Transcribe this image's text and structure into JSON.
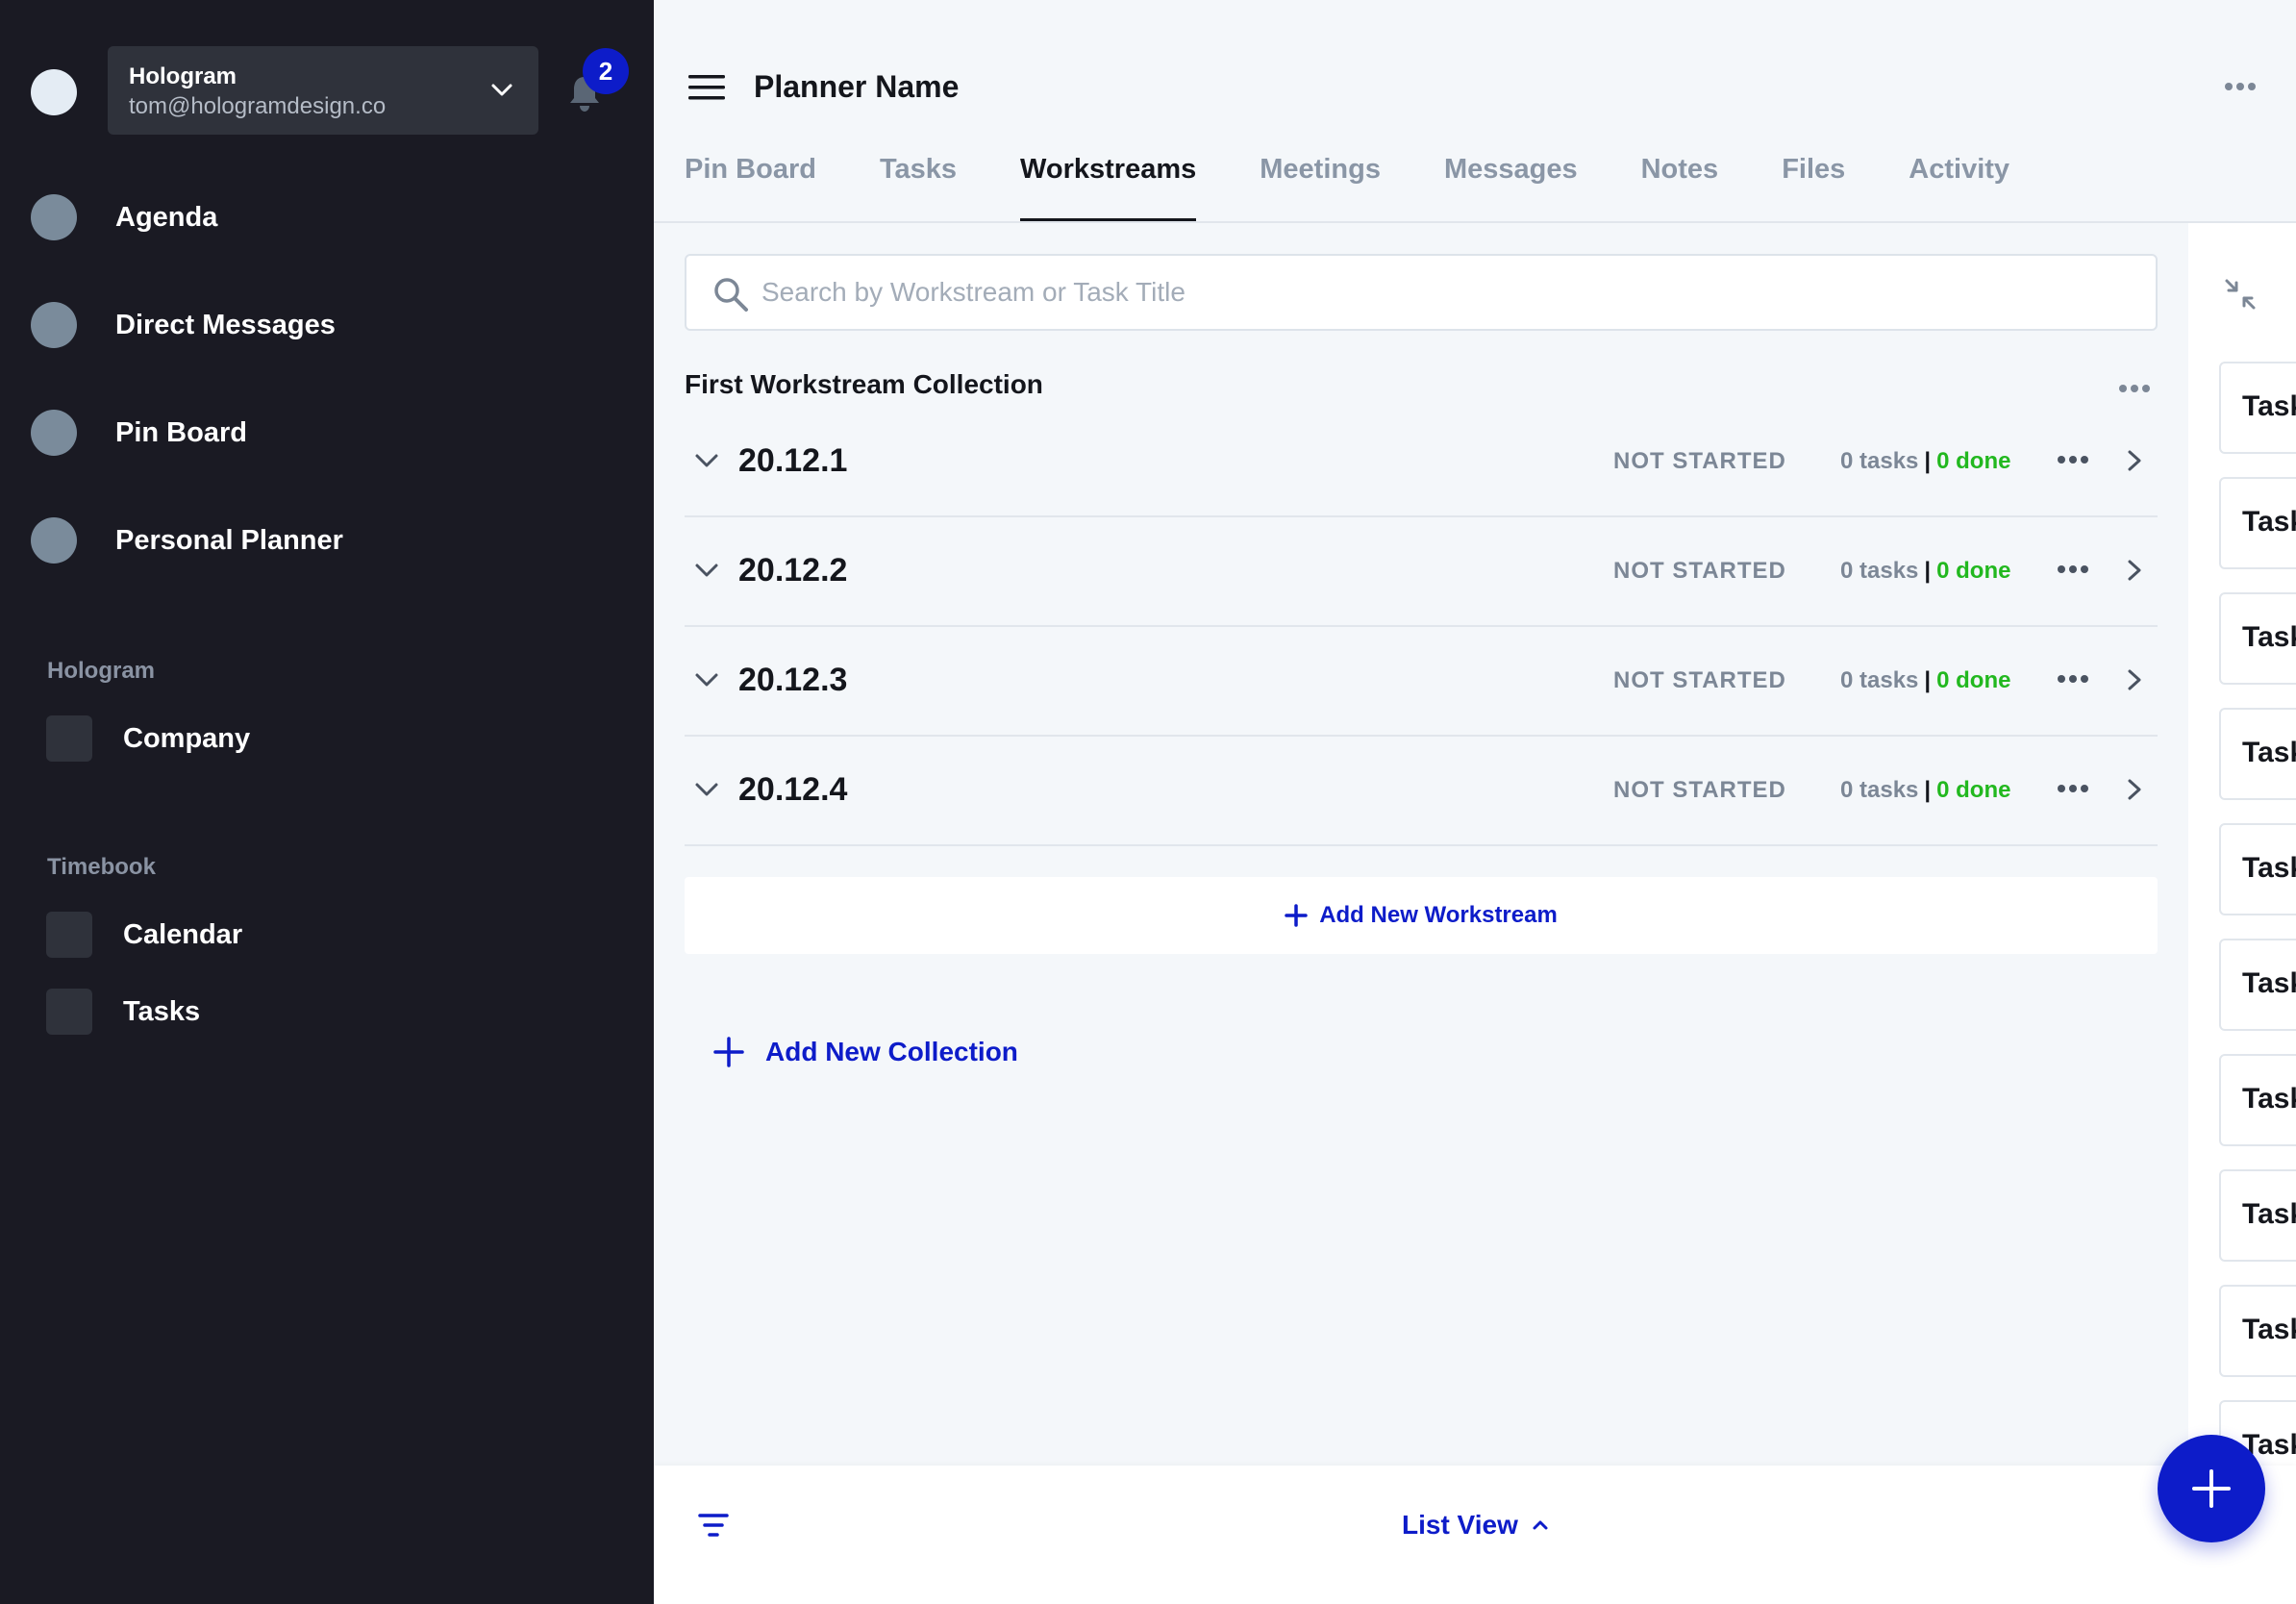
{
  "account": {
    "name": "Hologram",
    "email": "tom@hologramdesign.co",
    "notification_count": "2"
  },
  "sidebar": {
    "nav": [
      {
        "label": "Agenda"
      },
      {
        "label": "Direct Messages"
      },
      {
        "label": "Pin Board"
      },
      {
        "label": "Personal Planner"
      }
    ],
    "sections": [
      {
        "title": "Hologram",
        "items": [
          {
            "label": "Company"
          }
        ]
      },
      {
        "title": "Timebook",
        "items": [
          {
            "label": "Calendar"
          },
          {
            "label": "Tasks"
          }
        ]
      }
    ]
  },
  "header": {
    "title": "Planner Name",
    "tabs": [
      {
        "label": "Pin Board"
      },
      {
        "label": "Tasks"
      },
      {
        "label": "Workstreams",
        "active": true
      },
      {
        "label": "Meetings"
      },
      {
        "label": "Messages"
      },
      {
        "label": "Notes"
      },
      {
        "label": "Files"
      },
      {
        "label": "Activity"
      }
    ]
  },
  "search": {
    "placeholder": "Search by Workstream or Task Title",
    "value": ""
  },
  "collection": {
    "title": "First Workstream Collection",
    "workstreams": [
      {
        "name": "20.12.1",
        "status": "NOT STARTED",
        "tasks": "0 tasks",
        "sep": "|",
        "done": "0 done"
      },
      {
        "name": "20.12.2",
        "status": "NOT STARTED",
        "tasks": "0 tasks",
        "sep": "|",
        "done": "0 done"
      },
      {
        "name": "20.12.3",
        "status": "NOT STARTED",
        "tasks": "0 tasks",
        "sep": "|",
        "done": "0 done"
      },
      {
        "name": "20.12.4",
        "status": "NOT STARTED",
        "tasks": "0 tasks",
        "sep": "|",
        "done": "0 done"
      }
    ],
    "add_workstream_label": "Add New Workstream",
    "add_collection_label": "Add New Collection"
  },
  "right_panel": {
    "cards": [
      "Task",
      "Task",
      "Task",
      "Task",
      "Task",
      "Task",
      "Task",
      "Task",
      "Task",
      "Task"
    ]
  },
  "bottom_bar": {
    "view_label": "List View"
  },
  "colors": {
    "accent": "#0d1cc9",
    "done_green": "#22b81f",
    "sidebar_bg": "#1a1a23"
  }
}
